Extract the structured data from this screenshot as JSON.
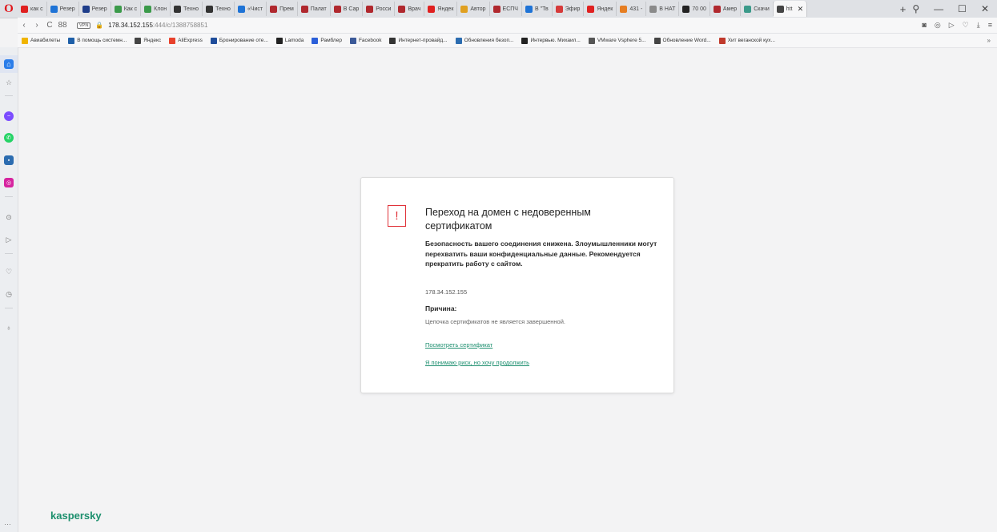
{
  "browser": {
    "tabs": [
      {
        "label": "как с",
        "color": "#e02020"
      },
      {
        "label": "Резер",
        "color": "#1e73d6"
      },
      {
        "label": "Резер",
        "color": "#1e3d8a"
      },
      {
        "label": "Как с",
        "color": "#3b9a4a"
      },
      {
        "label": "Клон",
        "color": "#3b9a4a"
      },
      {
        "label": "Техно",
        "color": "#333333"
      },
      {
        "label": "Техно",
        "color": "#333333"
      },
      {
        "label": "«Чист",
        "color": "#1e73d6"
      },
      {
        "label": "Прем",
        "color": "#b0282e"
      },
      {
        "label": "Палат",
        "color": "#b0282e"
      },
      {
        "label": "В Сар",
        "color": "#b0282e"
      },
      {
        "label": "Росси",
        "color": "#b0282e"
      },
      {
        "label": "Врач",
        "color": "#b0282e"
      },
      {
        "label": "Яндек",
        "color": "#e02020"
      },
      {
        "label": "Автор",
        "color": "#e0a020"
      },
      {
        "label": "ЕСПЧ",
        "color": "#b0282e"
      },
      {
        "label": "В \"Тв",
        "color": "#1e73d6"
      },
      {
        "label": "Эфир",
        "color": "#d63a3a"
      },
      {
        "label": "Яндек",
        "color": "#e02020"
      },
      {
        "label": "431 -",
        "color": "#e67e22"
      },
      {
        "label": "В НАТ",
        "color": "#8a8a8a"
      },
      {
        "label": "70 00",
        "color": "#222222"
      },
      {
        "label": "Амер",
        "color": "#b0282e"
      },
      {
        "label": "Скачи",
        "color": "#3b9a8a"
      }
    ],
    "active_tab": {
      "label": "htt",
      "close": "✕",
      "color": "#444444"
    },
    "new_tab": "+",
    "window_controls": {
      "search": "⚲",
      "minimize": "—",
      "maximize": "☐",
      "close": "✕"
    },
    "address": {
      "back": "‹",
      "forward": "›",
      "reload": "C",
      "speed_dial": "88",
      "vpn": "VPN",
      "lock": "🔒",
      "host": "178.34.152.155",
      "rest": ":444/c/1388758851"
    },
    "bookmarks": [
      {
        "label": "Авиабилеты",
        "color": "#f0b400"
      },
      {
        "label": "В помощь системн...",
        "color": "#1e5fa8"
      },
      {
        "label": "Яндекс",
        "color": "#444444"
      },
      {
        "label": "AliExpress",
        "color": "#e8412c"
      },
      {
        "label": "Бронирование оте...",
        "color": "#1e4c9a"
      },
      {
        "label": "Lamoda",
        "color": "#222222"
      },
      {
        "label": "Рамблер",
        "color": "#2b5fd9"
      },
      {
        "label": "Facebook",
        "color": "#3b5998"
      },
      {
        "label": "Интернет-провайд...",
        "color": "#333333"
      },
      {
        "label": "Обновления безоп...",
        "color": "#2b6cb0"
      },
      {
        "label": "Интервью. Михаил...",
        "color": "#222222"
      },
      {
        "label": "VMware Vsphere 5...",
        "color": "#555555"
      },
      {
        "label": "Обновление Word...",
        "color": "#444444"
      },
      {
        "label": "Хит веганской кух...",
        "color": "#c0392b"
      }
    ],
    "bookmarks_more": "»"
  },
  "dialog": {
    "title": "Переход на домен с недоверенным сертификатом",
    "body": "Безопасность вашего соединения снижена. Злоумышленники могут перехватить ваши конфиденциальные данные. Рекомендуется прекратить работу с сайтом.",
    "ip": "178.34.152.155",
    "reason_label": "Причина:",
    "reason_text": "Цепочка сертификатов не является завершенной.",
    "view_cert_link": "Посмотреть сертификат",
    "proceed_link": "Я понимаю риск, но хочу продолжить",
    "icon": "!"
  },
  "brand": "kaspersky",
  "colors": {
    "accent": "#1c8f6d",
    "warning": "#e0333a"
  }
}
